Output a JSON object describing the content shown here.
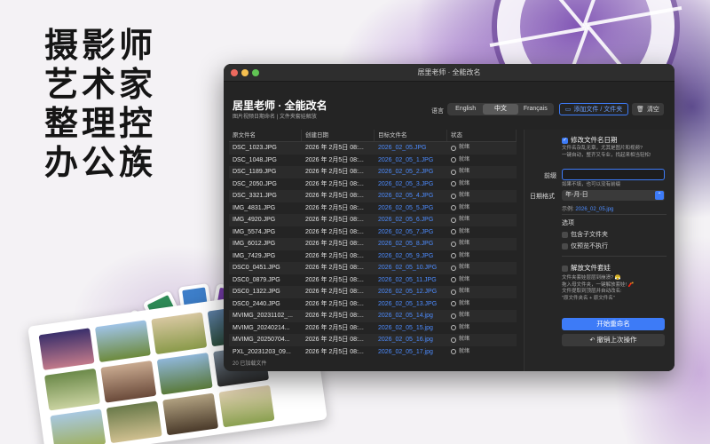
{
  "promo": {
    "slogan": [
      "摄影师",
      "艺术家",
      "整理控",
      "办公族"
    ]
  },
  "window": {
    "title": "居里老师 · 全能改名",
    "app_title": "居里老师 · 全能改名",
    "app_subtitle": "图片视频日期命名 | 文件夹套娃解放",
    "language_label": "语言",
    "languages": [
      "English",
      "中文",
      "Français"
    ],
    "selected_language": "中文",
    "add_button": "添加文件 / 文件夹",
    "clear_button": "清空",
    "columns": [
      "原文件名",
      "创建日期",
      "目标文件名",
      "状态"
    ],
    "rows": [
      {
        "orig": "DSC_1023.JPG",
        "date": "2026 年 2月5日 08:...",
        "target": "2026_02_05.JPG",
        "status": "就绪"
      },
      {
        "orig": "DSC_1048.JPG",
        "date": "2026 年 2月5日 08:...",
        "target": "2026_02_05_1.JPG",
        "status": "就绪"
      },
      {
        "orig": "DSC_1189.JPG",
        "date": "2026 年 2月5日 08:...",
        "target": "2026_02_05_2.JPG",
        "status": "就绪"
      },
      {
        "orig": "DSC_2050.JPG",
        "date": "2026 年 2月5日 08:...",
        "target": "2026_02_05_3.JPG",
        "status": "就绪"
      },
      {
        "orig": "DSC_3321.JPG",
        "date": "2026 年 2月5日 08:...",
        "target": "2026_02_05_4.JPG",
        "status": "就绪"
      },
      {
        "orig": "IMG_4831.JPG",
        "date": "2026 年 2月5日 08:...",
        "target": "2026_02_05_5.JPG",
        "status": "就绪"
      },
      {
        "orig": "IMG_4920.JPG",
        "date": "2026 年 2月5日 08:...",
        "target": "2026_02_05_6.JPG",
        "status": "就绪"
      },
      {
        "orig": "IMG_5574.JPG",
        "date": "2026 年 2月5日 08:...",
        "target": "2026_02_05_7.JPG",
        "status": "就绪"
      },
      {
        "orig": "IMG_6012.JPG",
        "date": "2026 年 2月5日 08:...",
        "target": "2026_02_05_8.JPG",
        "status": "就绪"
      },
      {
        "orig": "IMG_7429.JPG",
        "date": "2026 年 2月5日 08:...",
        "target": "2026_02_05_9.JPG",
        "status": "就绪"
      },
      {
        "orig": "DSC0_0451.JPG",
        "date": "2026 年 2月5日 08:...",
        "target": "2026_02_05_10.JPG",
        "status": "就绪"
      },
      {
        "orig": "DSC0_0879.JPG",
        "date": "2026 年 2月5日 08:...",
        "target": "2026_02_05_11.JPG",
        "status": "就绪"
      },
      {
        "orig": "DSC0_1322.JPG",
        "date": "2026 年 2月5日 08:...",
        "target": "2026_02_05_12.JPG",
        "status": "就绪"
      },
      {
        "orig": "DSC0_2440.JPG",
        "date": "2026 年 2月5日 08:...",
        "target": "2026_02_05_13.JPG",
        "status": "就绪"
      },
      {
        "orig": "MVIMG_20231102_...",
        "date": "2026 年 2月5日 08:...",
        "target": "2026_02_05_14.jpg",
        "status": "就绪"
      },
      {
        "orig": "MVIMG_20240214...",
        "date": "2026 年 2月5日 08:...",
        "target": "2026_02_05_15.jpg",
        "status": "就绪"
      },
      {
        "orig": "MVIMG_20250704...",
        "date": "2026 年 2月5日 08:...",
        "target": "2026_02_05_16.jpg",
        "status": "就绪"
      },
      {
        "orig": "PXL_20231203_09...",
        "date": "2026 年 2月5日 08:...",
        "target": "2026_02_05_17.jpg",
        "status": "就绪"
      }
    ],
    "file_count": "20 已加载文件",
    "panel": {
      "date_rename_label": "修改文件名日期",
      "date_rename_desc": "文件名杂乱无章，尤其是图片和视频?\n一键自动，整齐又专业，找起来相当轻松!",
      "prefix_label": "前缀",
      "prefix_value": "",
      "prefix_hint": "如果不填，也可以没有前缀",
      "date_format_label": "日期格式",
      "date_format_value": "年-月-日",
      "example_prefix": "示例:",
      "example_value": "2026_02_05.jpg",
      "options_label": "选项",
      "include_subfolders": "包含子文件夹",
      "preview_only": "仅预览不执行",
      "unnest_label": "解放文件套娃",
      "unnest_desc": "文件夹套娃层层到崩溃? 😤\n拖入母文件夹，一键解放套娃! 🧨\n文件提取到顶层并自动改名:\n\"原文件夹名 + 原文件名\"",
      "start_button": "开始重命名",
      "undo_button": "撤销上次操作"
    }
  }
}
